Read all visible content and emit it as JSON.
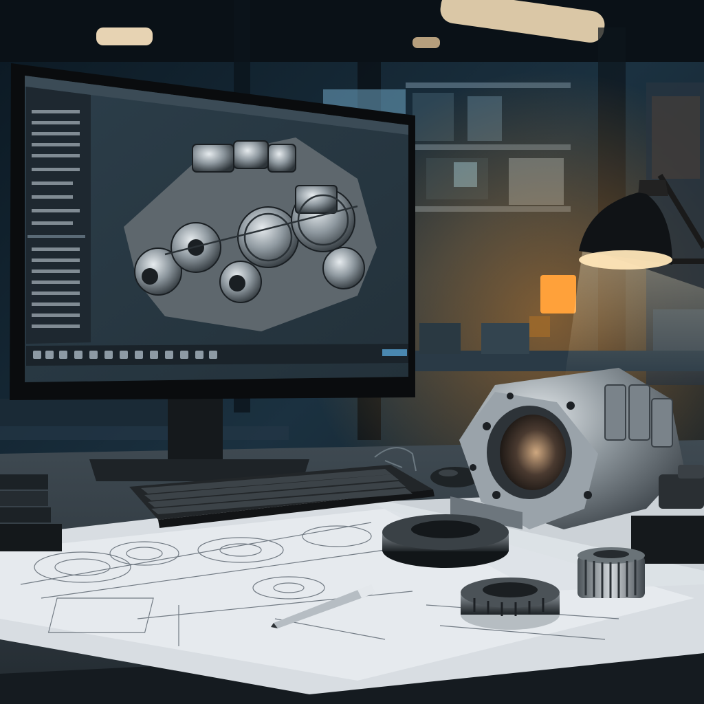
{
  "scene": {
    "palette": {
      "background": "#0f1d28",
      "steel_blue": "#3c5a70",
      "warm_light": "#ffb24a",
      "paper": "#e4e8ec",
      "metal": "#9aa3aa",
      "screen_bg": "#2a3a44"
    },
    "icons": [
      "monitor",
      "cad-model",
      "gearbox-casting",
      "keyboard",
      "desk-lamp",
      "blueprint",
      "pen",
      "gear",
      "bearing-ring"
    ]
  }
}
